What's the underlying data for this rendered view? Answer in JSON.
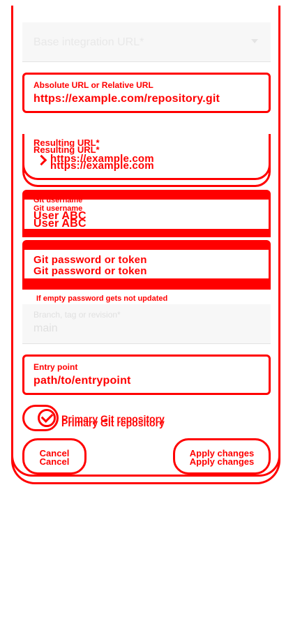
{
  "base_url": {
    "label": "Base integration URL*"
  },
  "absolute_url": {
    "label": "Absolute URL or Relative URL",
    "value": "https://example.com/repository.git"
  },
  "resulting_url": {
    "label": "Resulting URL*",
    "value": "https://example.com"
  },
  "git_username": {
    "label": "Git username",
    "value": "User ABC"
  },
  "git_password": {
    "label": "Git password or token",
    "hint": "If empty password gets not updated"
  },
  "branch": {
    "label": "Branch, tag or revision*",
    "value": "main"
  },
  "entry_point": {
    "label": "Entry point",
    "value": "path/to/entrypoint"
  },
  "primary_repo": {
    "label": "Primary Git repository",
    "checked": true
  },
  "actions": {
    "cancel": "Cancel",
    "apply": "Apply changes"
  },
  "colors": {
    "accent": "#ff0000",
    "faded": "#e0e0e0"
  }
}
